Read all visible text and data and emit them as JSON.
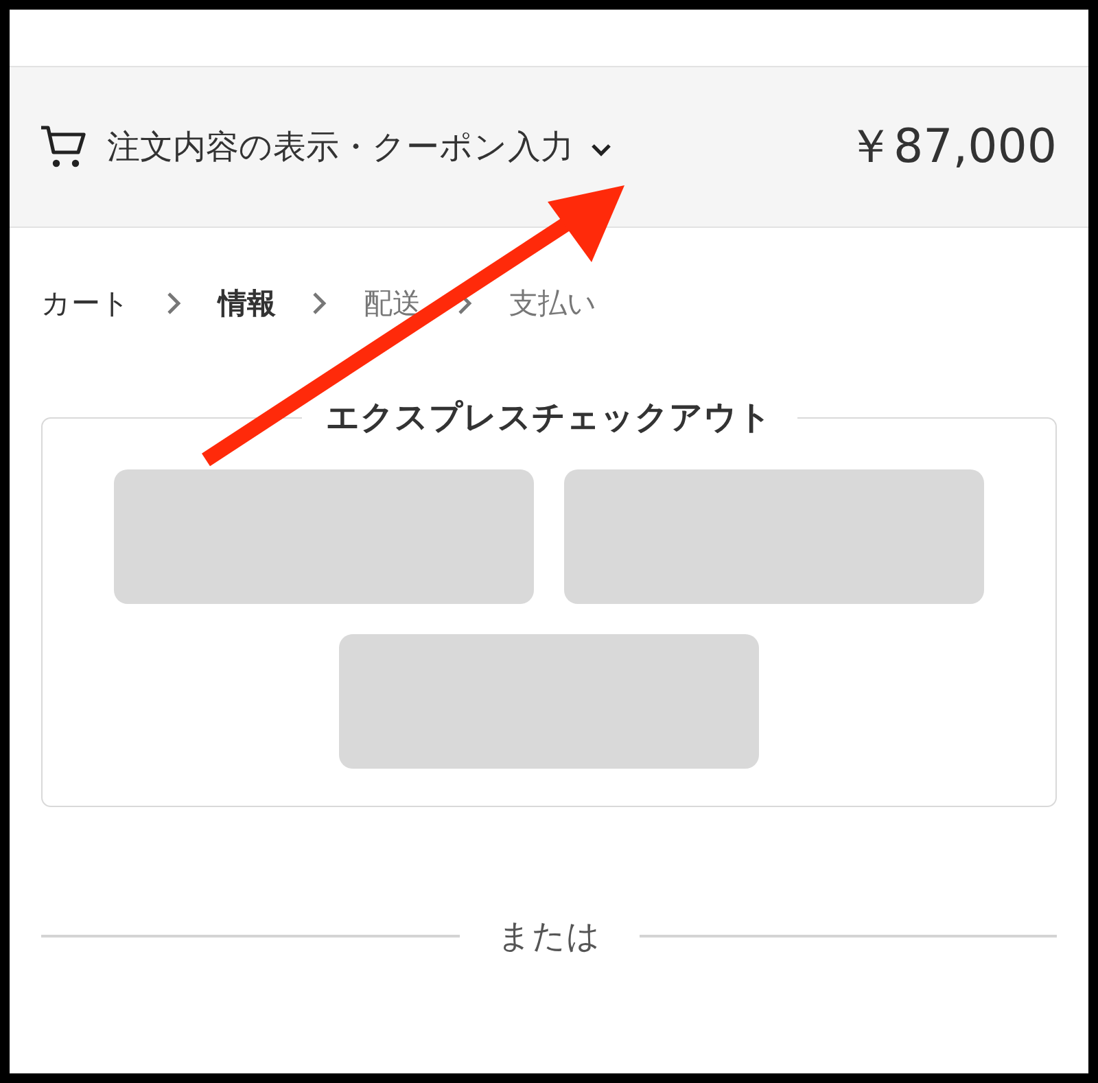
{
  "order_summary": {
    "label": "注文内容の表示・クーポン入力",
    "expanded": false,
    "total": "￥87,000"
  },
  "breadcrumb": [
    {
      "label": "カート",
      "selected": false,
      "disabled": false
    },
    {
      "label": "情報",
      "selected": true,
      "disabled": false
    },
    {
      "label": "配送",
      "selected": false,
      "disabled": true
    },
    {
      "label": "支払い",
      "selected": false,
      "disabled": true
    }
  ],
  "express_checkout": {
    "title": "エクスプレスチェックアウト",
    "buttons": [
      {
        "kind": "placeholder"
      },
      {
        "kind": "placeholder"
      },
      {
        "kind": "placeholder"
      }
    ]
  },
  "divider": {
    "label": "または"
  },
  "annotation": {
    "kind": "arrow"
  }
}
